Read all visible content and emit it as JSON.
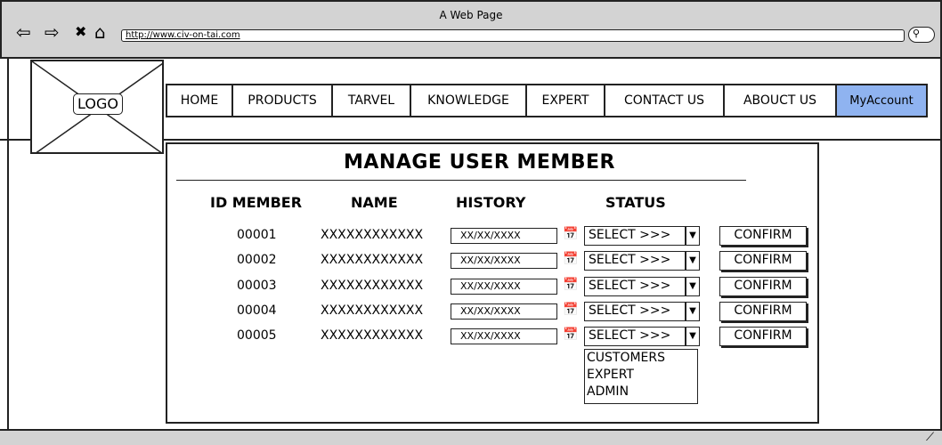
{
  "window": {
    "title": "A Web Page",
    "url": "http://www.civ-on-tai.com"
  },
  "icons": {
    "back": "back-arrow-icon",
    "forward": "forward-arrow-icon",
    "close": "close-icon",
    "home": "home-icon",
    "search": "search-icon"
  },
  "logo": {
    "label": "LOGO"
  },
  "nav": {
    "items": [
      "HOME",
      "PRODUCTS",
      "TARVEL",
      "KNOWLEDGE",
      "EXPERT",
      "CONTACT US",
      "ABOUCT US",
      "MyAccount"
    ],
    "active": "MyAccount",
    "active_color": "#8fb3f0"
  },
  "page": {
    "title": "MANAGE USER MEMBER",
    "columns": [
      "ID MEMBER",
      "NAME",
      "HISTORY",
      "STATUS"
    ],
    "rows": [
      {
        "id": "00001",
        "name": "XXXXXXXXXXXX",
        "date": "XX/XX/XXXX",
        "status": "SELECT >>>",
        "action": "CONFIRM"
      },
      {
        "id": "00002",
        "name": "XXXXXXXXXXXX",
        "date": "XX/XX/XXXX",
        "status": "SELECT >>>",
        "action": "CONFIRM"
      },
      {
        "id": "00003",
        "name": "XXXXXXXXXXXX",
        "date": "XX/XX/XXXX",
        "status": "SELECT >>>",
        "action": "CONFIRM"
      },
      {
        "id": "00004",
        "name": "XXXXXXXXXXXX",
        "date": "XX/XX/XXXX",
        "status": "SELECT >>>",
        "action": "CONFIRM"
      },
      {
        "id": "00005",
        "name": "XXXXXXXXXXXX",
        "date": "XX/XX/XXXX",
        "status": "SELECT >>>",
        "action": "CONFIRM"
      }
    ],
    "dropdown_options": [
      "CUSTOMERS",
      "EXPERT",
      "ADMIN"
    ]
  }
}
